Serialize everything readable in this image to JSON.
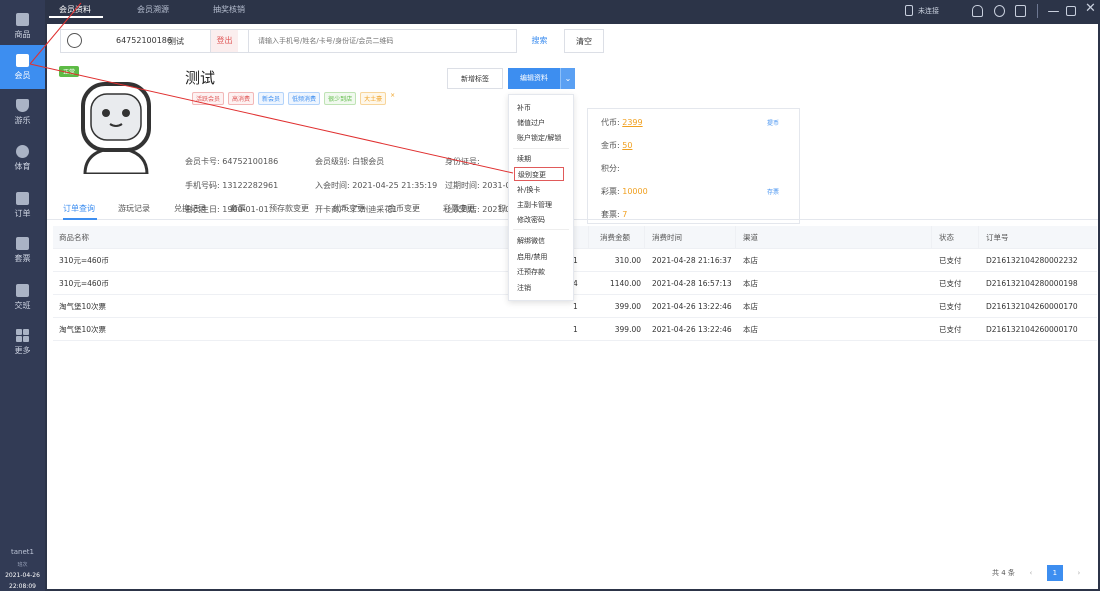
{
  "sidebar": {
    "items": [
      {
        "label": "商品",
        "icon": "product-icon"
      },
      {
        "label": "会员",
        "icon": "vip-card-icon",
        "active": true
      },
      {
        "label": "游乐",
        "icon": "shield-icon"
      },
      {
        "label": "体育",
        "icon": "ball-icon"
      },
      {
        "label": "订单",
        "icon": "order-icon"
      },
      {
        "label": "套票",
        "icon": "ticket-icon"
      },
      {
        "label": "交班",
        "icon": "shift-icon"
      },
      {
        "label": "更多",
        "icon": "more-grid-icon"
      }
    ],
    "user": "tanet1",
    "time_label": "班次",
    "date": "2021-04-26",
    "time": "22:08:09"
  },
  "topbar": {
    "tabs": [
      "会员资料",
      "会员溯源",
      "抽奖核销"
    ],
    "connection": "未连接"
  },
  "searchbar": {
    "member_card": "64752100186",
    "member_name": "测试",
    "logout": "登出",
    "search_placeholder": "请输入手机号/姓名/卡号/身份证/会员二维码",
    "search": "搜索",
    "clear": "清空"
  },
  "profile": {
    "badge": "正常",
    "name": "测试",
    "labels": [
      {
        "text": "活跃会员",
        "color": "#e05a5a"
      },
      {
        "text": "高消费",
        "color": "#e05a5a"
      },
      {
        "text": "新会员",
        "color": "#3d8ef0"
      },
      {
        "text": "低频消费",
        "color": "#3d8ef0"
      },
      {
        "text": "很少到店",
        "color": "#5dbb46"
      },
      {
        "text": "大土豪",
        "color": "#f0a020"
      },
      {
        "text": "×",
        "color": "#f0a020"
      }
    ],
    "card_no": "会员卡号: 64752100186",
    "level": "会员级别: 白银会员",
    "id_no": "身份证号:",
    "phone": "手机号码: 13122282961",
    "join_time": "入会时间: 2021-04-25 21:35:19",
    "expire": "过期时间: 2031-0",
    "birthday": "会员生日: 1900-01-01",
    "store": "开卡商户: 广州迪采花1",
    "last_visit": "上次到店: 2021/0",
    "add_tag": "新增标签",
    "edit": "编辑资料"
  },
  "dropdown": [
    "补币",
    "储值过户",
    "账户锁定/解锁",
    "续期",
    "级别变更",
    "补/换卡",
    "主副卡管理",
    "修改密码",
    "解绑微信",
    "启用/禁用",
    "迁预存款",
    "注销"
  ],
  "assets": {
    "coin_label": "代币:",
    "coin": "2399",
    "coin_btn": "提币",
    "gold_label": "金币:",
    "gold": "50",
    "points_label": "积分:",
    "points": "",
    "lottery_label": "彩票:",
    "lottery": "10000",
    "lottery_btn": "存票",
    "package_label": "套票:",
    "package": "7"
  },
  "tabs": [
    "订单查询",
    "游玩记录",
    "兑换记录",
    "套票",
    "预存款变更",
    "代币变更",
    "金币变更",
    "彩票变更",
    "积"
  ],
  "table": {
    "headers": [
      "商品名称",
      "消费金额",
      "消费时间",
      "渠道",
      "状态",
      "订单号"
    ],
    "rows": [
      {
        "name": "310元=460币",
        "qty": "1",
        "amount": "310.00",
        "time": "2021-04-28 21:16:37",
        "channel": "本店",
        "status": "已支付",
        "order": "D216132104280002232"
      },
      {
        "name": "310元=460币",
        "qty": "4",
        "amount": "1140.00",
        "time": "2021-04-28 16:57:13",
        "channel": "本店",
        "status": "已支付",
        "order": "D216132104280000198"
      },
      {
        "name": "淘气堡10次票",
        "qty": "1",
        "amount": "399.00",
        "time": "2021-04-26 13:22:46",
        "channel": "本店",
        "status": "已支付",
        "order": "D216132104260000170"
      },
      {
        "name": "淘气堡10次票",
        "qty": "1",
        "amount": "399.00",
        "time": "2021-04-26 13:22:46",
        "channel": "本店",
        "status": "已支付",
        "order": "D216132104260000170"
      }
    ]
  },
  "pager": {
    "total": "共 4 条",
    "page": "1",
    "prev": "‹",
    "next": "›"
  }
}
